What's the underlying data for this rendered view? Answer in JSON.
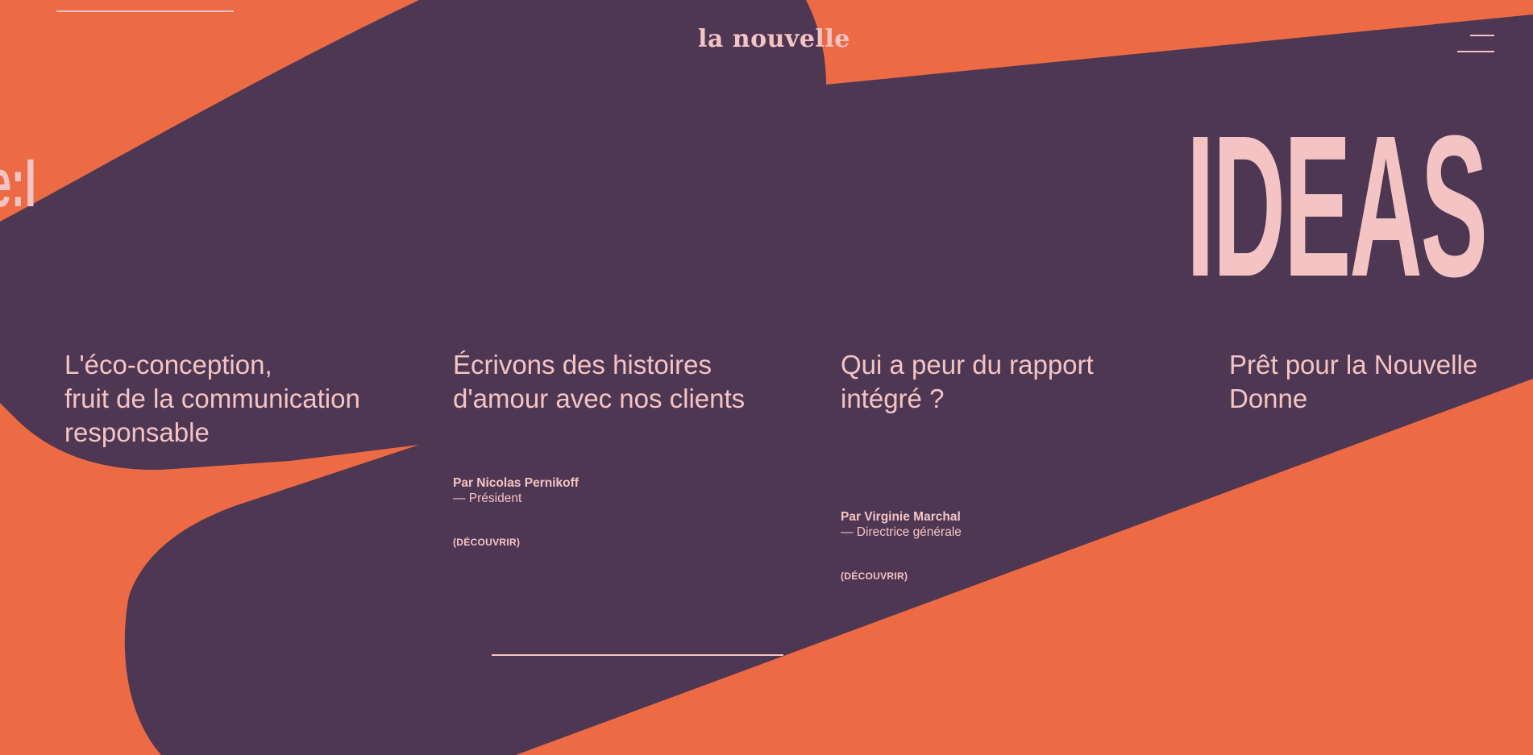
{
  "brand": {
    "logo": "la nouvelle"
  },
  "colors": {
    "background": "#ed6b44",
    "shape": "#4e3753",
    "text": "#f4c4c4"
  },
  "header": {
    "menu_icon": "hamburger-menu-icon"
  },
  "hero": {
    "ghost_text": "e:I",
    "heading": "IDEAS"
  },
  "articles": [
    {
      "title": "L'éco-conception,\nfruit de la communication\nresponsable",
      "author": "",
      "role": "",
      "cta": ""
    },
    {
      "title": "Écrivons des histoires\nd'amour avec nos clients",
      "author": "Par Nicolas Pernikoff",
      "role": "— Président",
      "cta": "(DÉCOUVRIR)"
    },
    {
      "title": "Qui a peur du rapport\nintégré ?",
      "author": "Par Virginie Marchal",
      "role": "— Directrice générale",
      "cta": "(DÉCOUVRIR)"
    },
    {
      "title": "Prêt pour la Nouvelle\nDonne",
      "author": "",
      "role": "",
      "cta": ""
    }
  ]
}
